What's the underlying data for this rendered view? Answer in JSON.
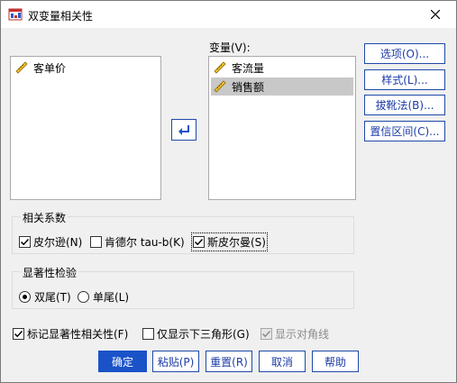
{
  "window": {
    "title": "双变量相关性"
  },
  "source_list": {
    "items": [
      {
        "label": "客单价"
      }
    ]
  },
  "variables": {
    "label": "变量(V):",
    "items": [
      {
        "label": "客流量",
        "selected": false
      },
      {
        "label": "销售额",
        "selected": true
      }
    ]
  },
  "side_buttons": {
    "options": "选项(O)...",
    "style": "样式(L)...",
    "bootstrap": "拔靴法(B)...",
    "confidence": "置信区间(C)..."
  },
  "correlation": {
    "title": "相关系数",
    "pearson": {
      "label": "皮尔逊(N)",
      "checked": true
    },
    "kendall": {
      "label": "肯德尔 tau-b(K)",
      "checked": false
    },
    "spearman": {
      "label": "斯皮尔曼(S)",
      "checked": true
    }
  },
  "significance": {
    "title": "显著性检验",
    "two_tailed": {
      "label": "双尾(T)",
      "selected": true
    },
    "one_tailed": {
      "label": "单尾(L)",
      "selected": false
    }
  },
  "options": {
    "flag": {
      "label": "标记显著性相关性(F)",
      "checked": true
    },
    "lower_triangle": {
      "label": "仅显示下三角形(G)",
      "checked": false
    },
    "diagonal": {
      "label": "显示对角线",
      "checked": true,
      "disabled": true
    }
  },
  "footer": {
    "ok": "确定",
    "paste": "粘贴(P)",
    "reset": "重置(R)",
    "cancel": "取消",
    "help": "帮助"
  },
  "colors": {
    "accent": "#1a52c8",
    "pencil": "#e0a800"
  }
}
